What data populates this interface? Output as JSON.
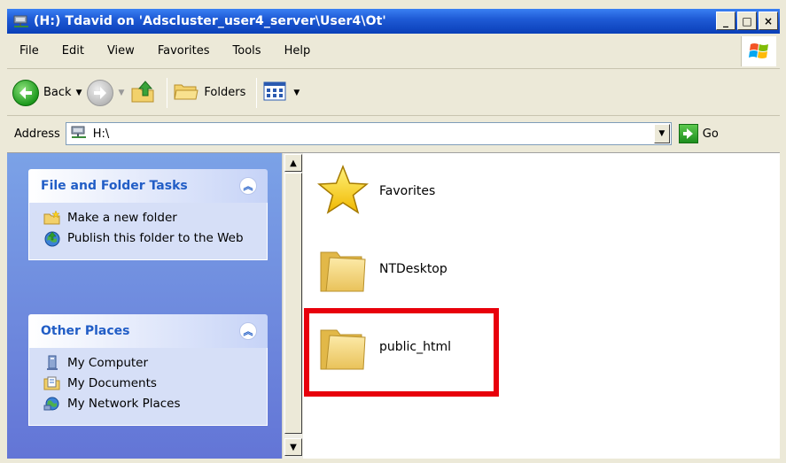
{
  "window": {
    "title": "(H:) Tdavid on 'Adscluster_user4_server\\User4\\Ot'",
    "controls": {
      "minimize": "_",
      "maximize": "□",
      "close": "×"
    }
  },
  "menu": {
    "items": [
      "File",
      "Edit",
      "View",
      "Favorites",
      "Tools",
      "Help"
    ]
  },
  "toolbar": {
    "back_label": "Back",
    "folders_label": "Folders"
  },
  "address": {
    "label": "Address",
    "value": "H:\\",
    "go_label": "Go"
  },
  "tasks": {
    "file_folder": {
      "title": "File and Folder Tasks",
      "items": [
        "Make a new folder",
        "Publish this folder to the Web"
      ]
    },
    "other_places": {
      "title": "Other Places",
      "items": [
        "My Computer",
        "My Documents",
        "My Network Places"
      ]
    }
  },
  "files": [
    {
      "name": "Favorites",
      "icon": "favorites-star-icon"
    },
    {
      "name": "NTDesktop",
      "icon": "folder-icon"
    },
    {
      "name": "public_html",
      "icon": "folder-icon"
    }
  ],
  "colors": {
    "title_bar": "#0A3FB8",
    "taskpane": "#6375D6",
    "highlight": "#E8000B"
  }
}
